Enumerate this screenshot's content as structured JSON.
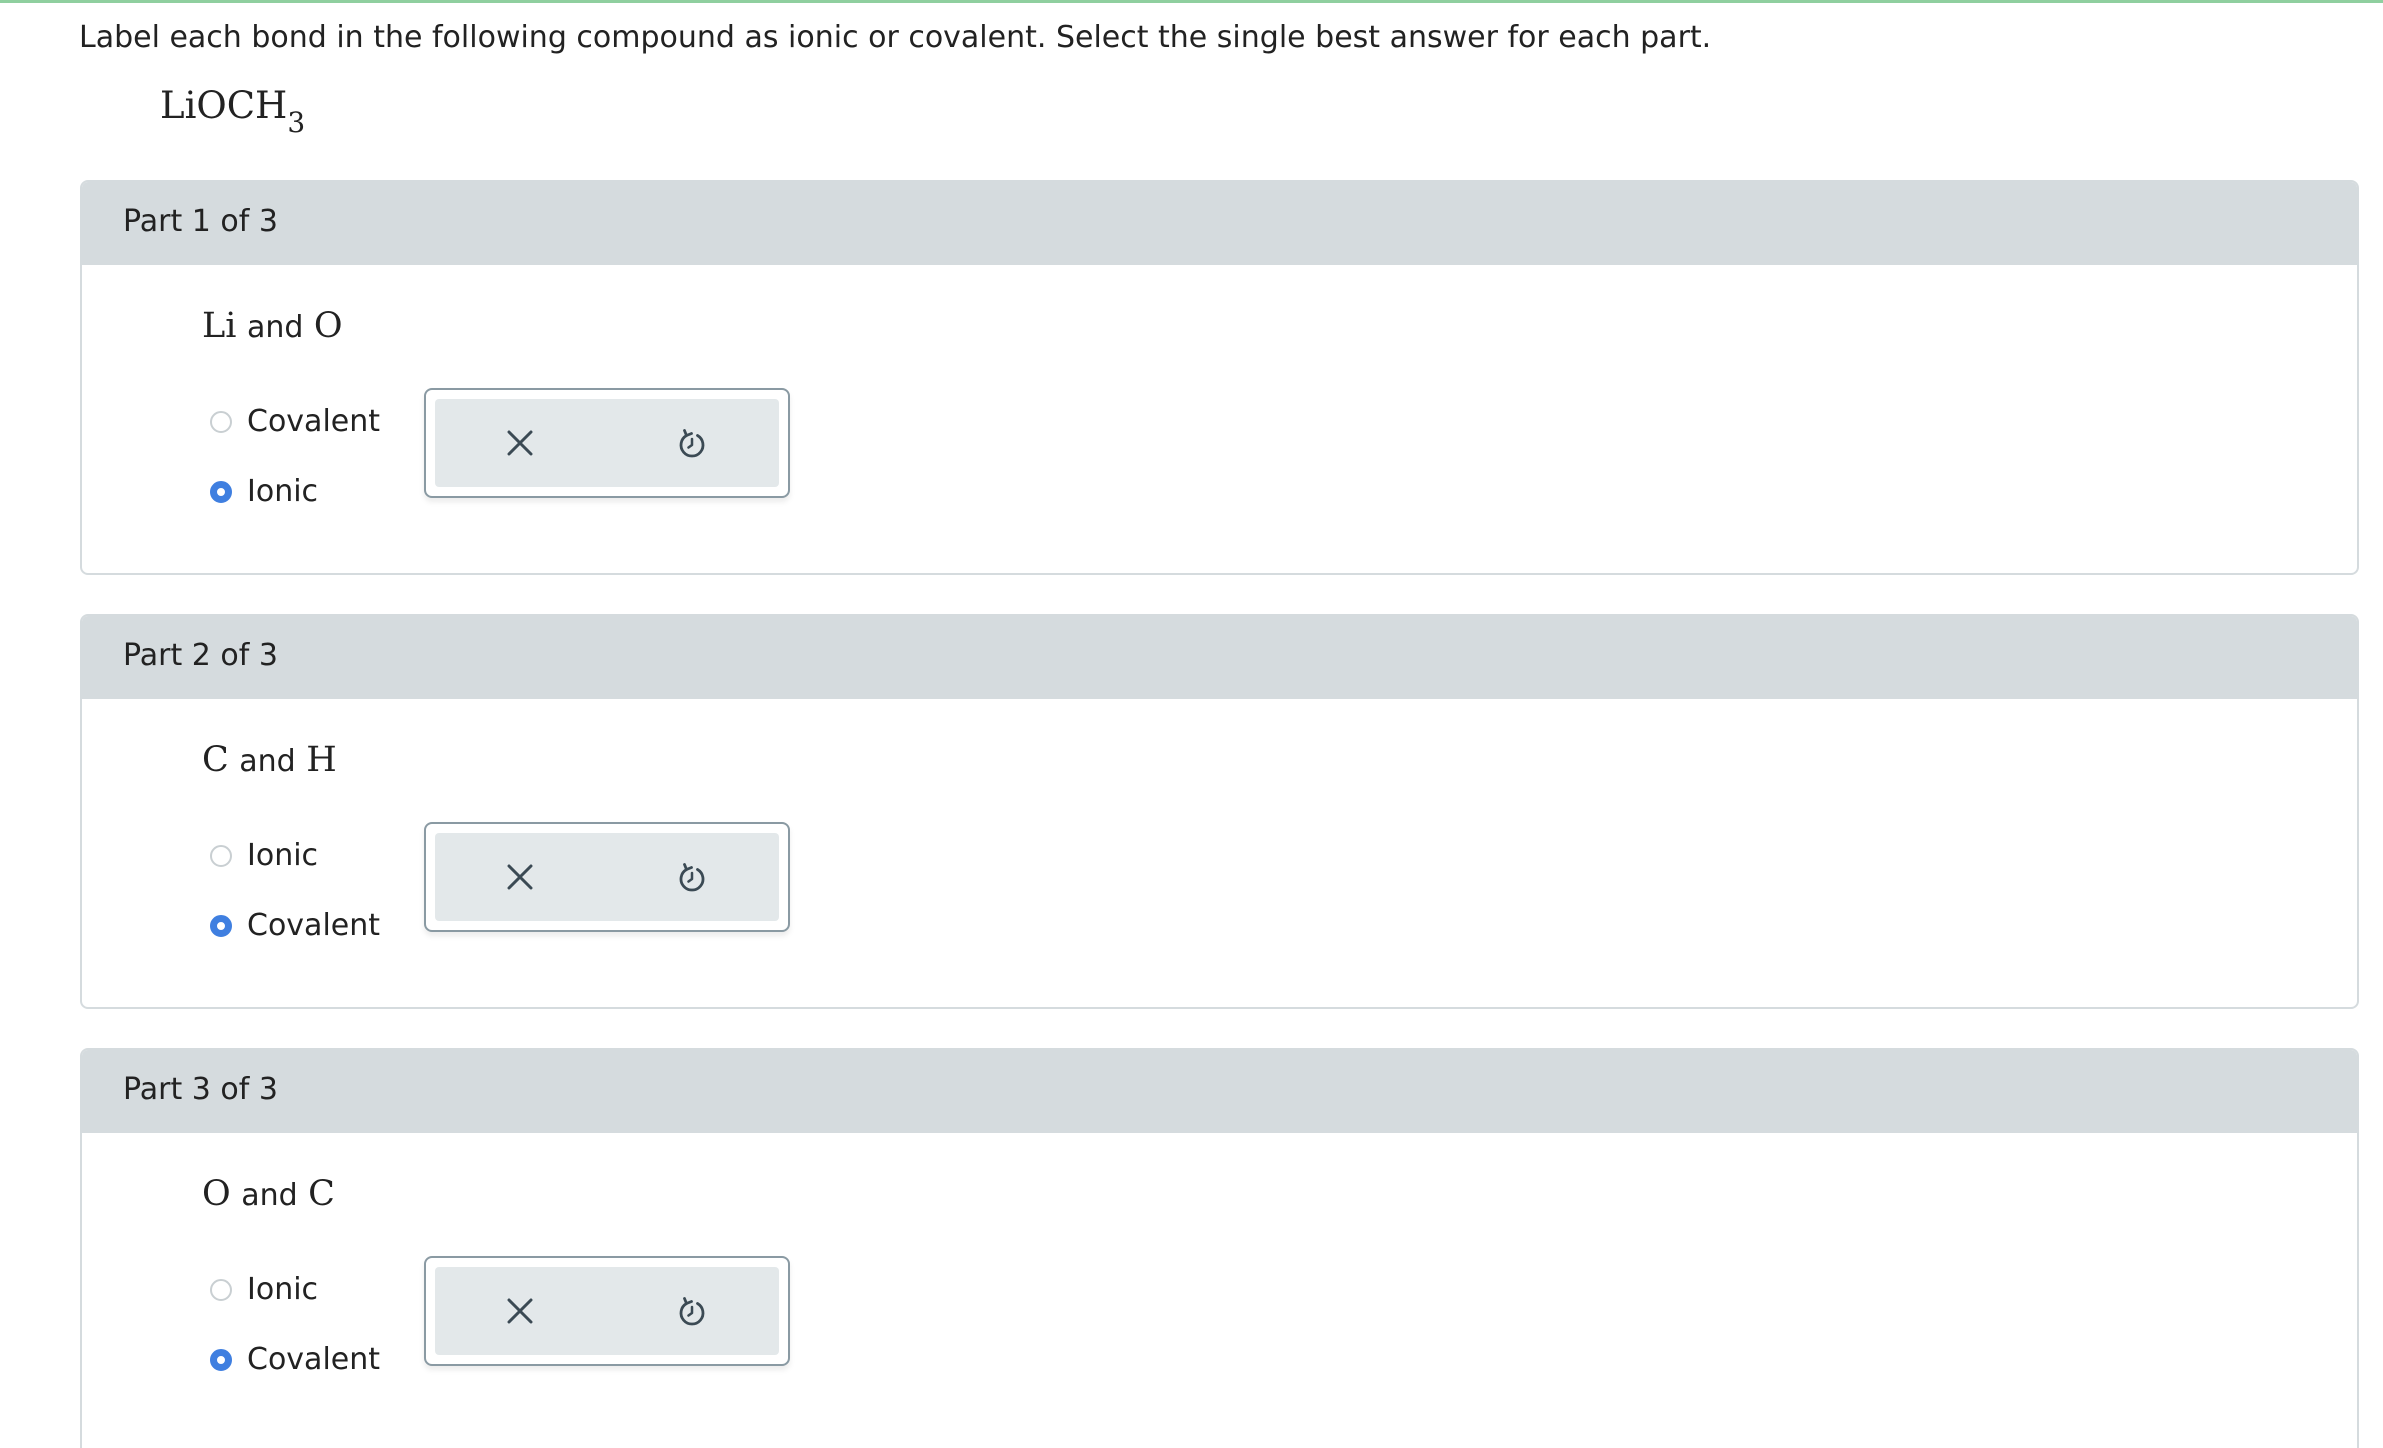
{
  "instructions": "Label each bond in the following compound as ionic or covalent. Select the single best answer for each part.",
  "compound": {
    "main": "LiOCH",
    "subscript": "3"
  },
  "parts": [
    {
      "title": "Part 1 of 3",
      "atom1": "Li",
      "conjunction": "and",
      "atom2": "O",
      "options": [
        {
          "label": "Covalent",
          "selected": false
        },
        {
          "label": "Ionic",
          "selected": true
        }
      ]
    },
    {
      "title": "Part 2 of 3",
      "atom1": "C",
      "conjunction": "and",
      "atom2": "H",
      "options": [
        {
          "label": "Ionic",
          "selected": false
        },
        {
          "label": "Covalent",
          "selected": true
        }
      ]
    },
    {
      "title": "Part 3 of 3",
      "atom1": "O",
      "conjunction": "and",
      "atom2": "C",
      "options": [
        {
          "label": "Ionic",
          "selected": false
        },
        {
          "label": "Covalent",
          "selected": true
        }
      ]
    }
  ],
  "tools": {
    "clear_icon": "close-icon",
    "undo_icon": "undo-icon"
  },
  "colors": {
    "accent_radio": "#3f7fe0",
    "header_bg": "#d5dbde",
    "toolbar_bg": "#e3e8ea",
    "top_rule": "#8fcf9f"
  }
}
